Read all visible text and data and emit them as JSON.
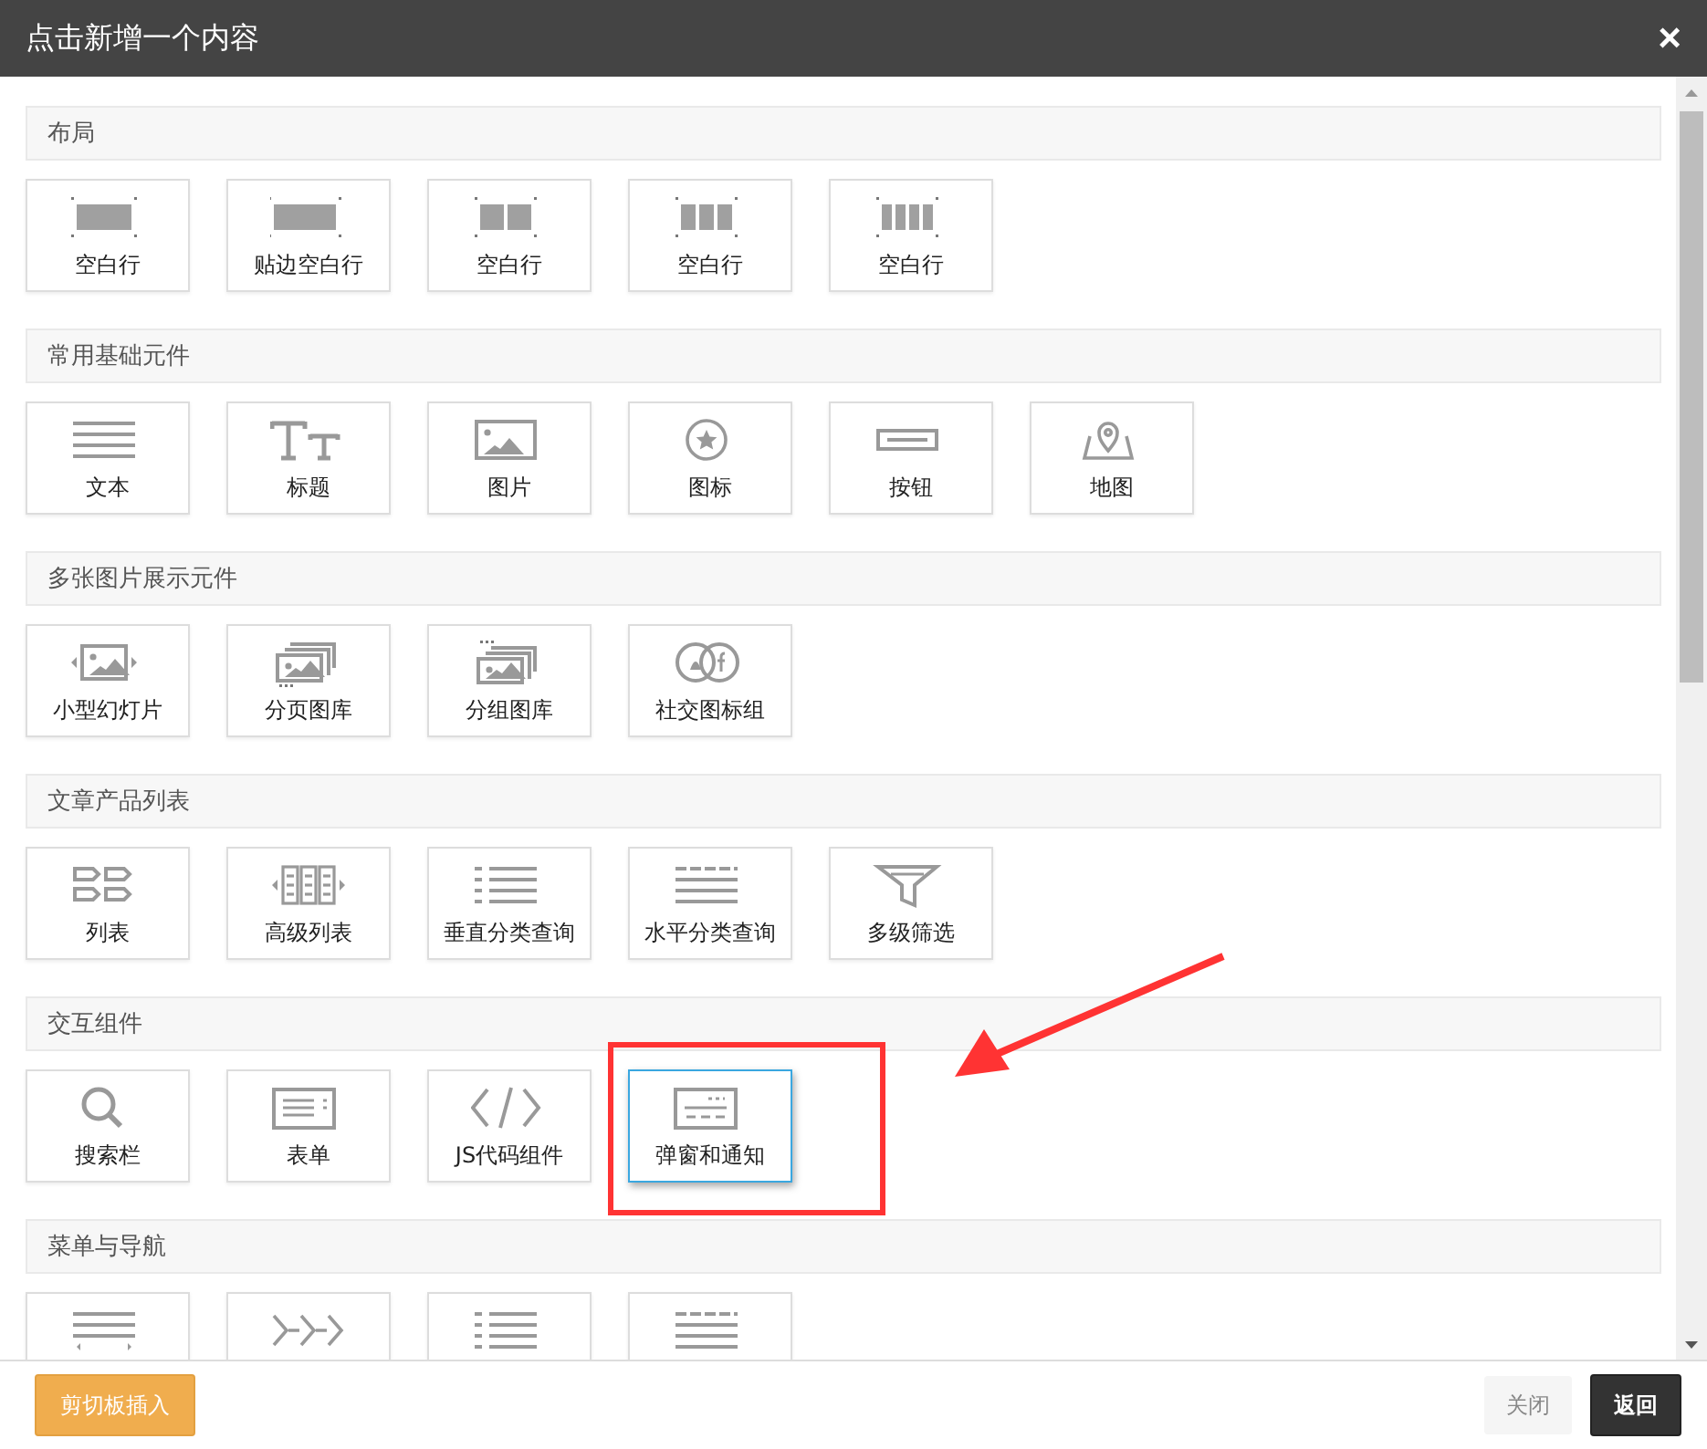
{
  "window": {
    "title": "点击新增一个内容",
    "close": "×"
  },
  "sections": [
    {
      "title": "布局",
      "tiles": [
        {
          "label": "空白行",
          "selected": false
        },
        {
          "label": "贴边空白行",
          "selected": false
        },
        {
          "label": "空白行",
          "selected": false
        },
        {
          "label": "空白行",
          "selected": false
        },
        {
          "label": "空白行",
          "selected": false
        }
      ]
    },
    {
      "title": "常用基础元件",
      "tiles": [
        {
          "label": "文本",
          "selected": false
        },
        {
          "label": "标题",
          "selected": false
        },
        {
          "label": "图片",
          "selected": false
        },
        {
          "label": "图标",
          "selected": false
        },
        {
          "label": "按钮",
          "selected": false
        },
        {
          "label": "地图",
          "selected": false
        }
      ]
    },
    {
      "title": "多张图片展示元件",
      "tiles": [
        {
          "label": "小型幻灯片",
          "selected": false
        },
        {
          "label": "分页图库",
          "selected": false
        },
        {
          "label": "分组图库",
          "selected": false
        },
        {
          "label": "社交图标组",
          "selected": false
        }
      ]
    },
    {
      "title": "文章产品列表",
      "tiles": [
        {
          "label": "列表",
          "selected": false
        },
        {
          "label": "高级列表",
          "selected": false
        },
        {
          "label": "垂直分类查询",
          "selected": false
        },
        {
          "label": "水平分类查询",
          "selected": false
        },
        {
          "label": "多级筛选",
          "selected": false
        }
      ]
    },
    {
      "title": "交互组件",
      "tiles": [
        {
          "label": "搜索栏",
          "selected": false
        },
        {
          "label": "表单",
          "selected": false
        },
        {
          "label": "JS代码组件",
          "selected": false
        },
        {
          "label": "弹窗和通知",
          "selected": true
        }
      ]
    },
    {
      "title": "菜单与导航",
      "tiles": [
        {
          "selected": false
        },
        {
          "selected": false
        },
        {
          "selected": false
        },
        {
          "selected": false
        }
      ]
    }
  ],
  "footer": {
    "paste_button": "剪切板插入",
    "close_button": "关闭",
    "back_button": "返回"
  }
}
